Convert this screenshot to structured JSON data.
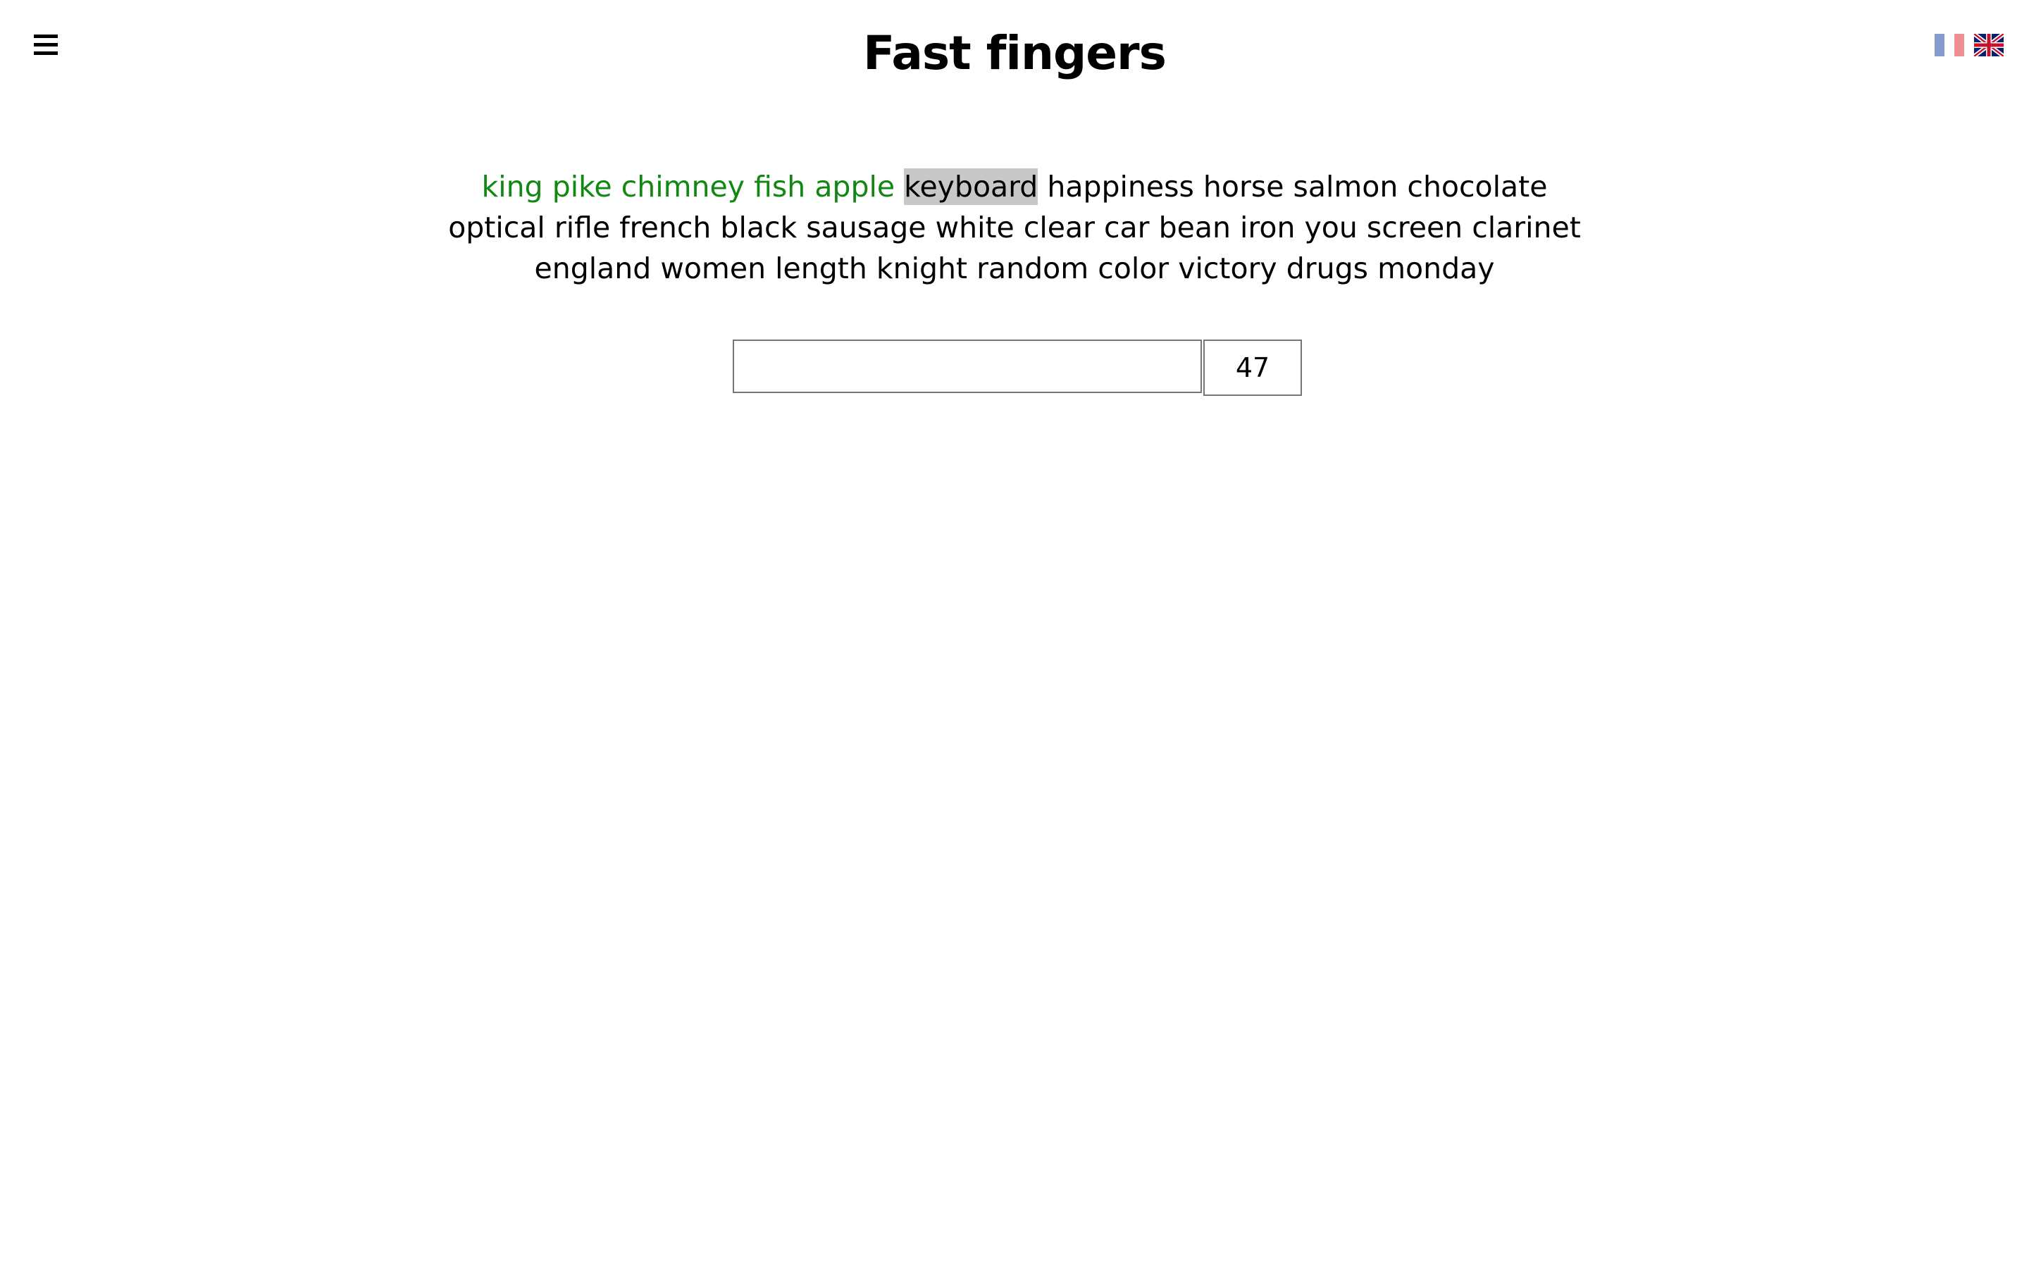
{
  "header": {
    "title": "Fast fingers",
    "menu_icon": "hamburger-icon",
    "languages": [
      {
        "code": "fr",
        "icon": "france-flag-icon",
        "active": false
      },
      {
        "code": "en",
        "icon": "uk-flag-icon",
        "active": true
      }
    ]
  },
  "words": {
    "typed": [
      "king",
      "pike",
      "chimney",
      "fish",
      "apple"
    ],
    "current": "keyboard",
    "upcoming": [
      "happiness",
      "horse",
      "salmon",
      "chocolate",
      "optical",
      "rifle",
      "french",
      "black",
      "sausage",
      "white",
      "clear",
      "car",
      "bean",
      "iron",
      "you",
      "screen",
      "clarinet",
      "england",
      "women",
      "length",
      "knight",
      "random",
      "color",
      "victory",
      "drugs",
      "monday"
    ]
  },
  "input": {
    "value": "",
    "placeholder": ""
  },
  "timer": {
    "seconds": "47"
  },
  "colors": {
    "typed": "#118811",
    "current_highlight": "#c8c8c8",
    "text": "#000000"
  }
}
